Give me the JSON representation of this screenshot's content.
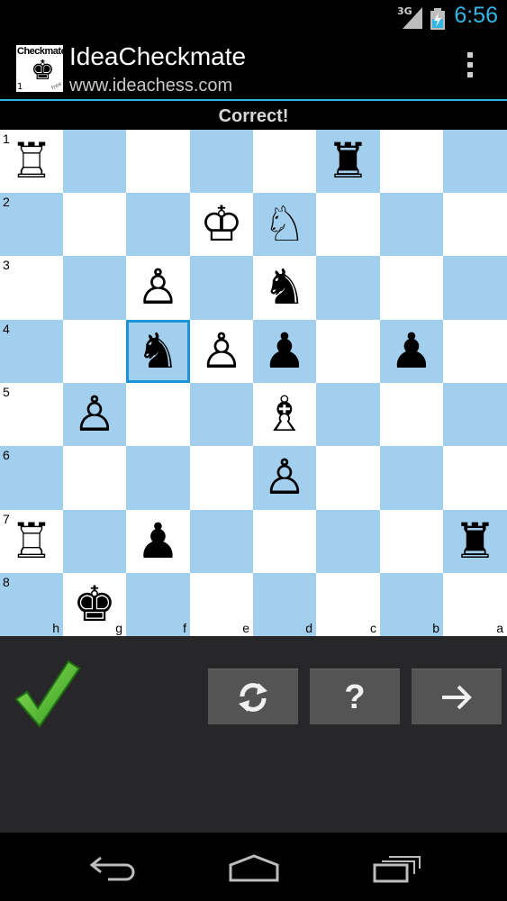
{
  "status_bar": {
    "network": "3G",
    "time": "6:56"
  },
  "app": {
    "title": "IdeaCheckmate",
    "subtitle": "www.ideachess.com",
    "logo": {
      "text": "Checkmate",
      "number": "1",
      "tag": "free"
    }
  },
  "message": "Correct!",
  "board": {
    "orientation": "black-bottom",
    "ranks": [
      "1",
      "2",
      "3",
      "4",
      "5",
      "6",
      "7",
      "8"
    ],
    "files": [
      "h",
      "g",
      "f",
      "e",
      "d",
      "c",
      "b",
      "a"
    ],
    "selected_square": "f4",
    "pieces": [
      {
        "square": "h1",
        "piece": "white-rook",
        "glyph": "♖"
      },
      {
        "square": "c1",
        "piece": "black-rook",
        "glyph": "♜"
      },
      {
        "square": "e2",
        "piece": "white-king",
        "glyph": "♔"
      },
      {
        "square": "d2",
        "piece": "white-knight",
        "glyph": "♘"
      },
      {
        "square": "f3",
        "piece": "white-pawn",
        "glyph": "♙"
      },
      {
        "square": "d3",
        "piece": "black-knight",
        "glyph": "♞"
      },
      {
        "square": "f4",
        "piece": "black-knight",
        "glyph": "♞"
      },
      {
        "square": "e4",
        "piece": "white-pawn",
        "glyph": "♙"
      },
      {
        "square": "d4",
        "piece": "black-pawn",
        "glyph": "♟"
      },
      {
        "square": "b4",
        "piece": "black-pawn",
        "glyph": "♟"
      },
      {
        "square": "g5",
        "piece": "white-pawn",
        "glyph": "♙"
      },
      {
        "square": "d5",
        "piece": "white-bishop",
        "glyph": "♗"
      },
      {
        "square": "d6",
        "piece": "white-pawn",
        "glyph": "♙"
      },
      {
        "square": "h7",
        "piece": "white-rook",
        "glyph": "♖"
      },
      {
        "square": "f7",
        "piece": "black-pawn",
        "glyph": "♟"
      },
      {
        "square": "a7",
        "piece": "black-rook",
        "glyph": "♜"
      },
      {
        "square": "g8",
        "piece": "black-king",
        "glyph": "♚"
      }
    ]
  },
  "controls": {
    "result_icon": "checkmark-icon",
    "buttons": [
      {
        "name": "restart-button",
        "icon": "refresh-icon"
      },
      {
        "name": "hint-button",
        "icon": "question-icon",
        "label": "?"
      },
      {
        "name": "next-button",
        "icon": "arrow-right-icon"
      }
    ]
  },
  "navigation": [
    "back-icon",
    "home-icon",
    "recent-apps-icon"
  ],
  "colors": {
    "accent": "#33b5e5",
    "light_square": "#ffffff",
    "dark_square": "#a3cfee",
    "selection": "#1d93d7",
    "check": "#5bbf2e"
  }
}
